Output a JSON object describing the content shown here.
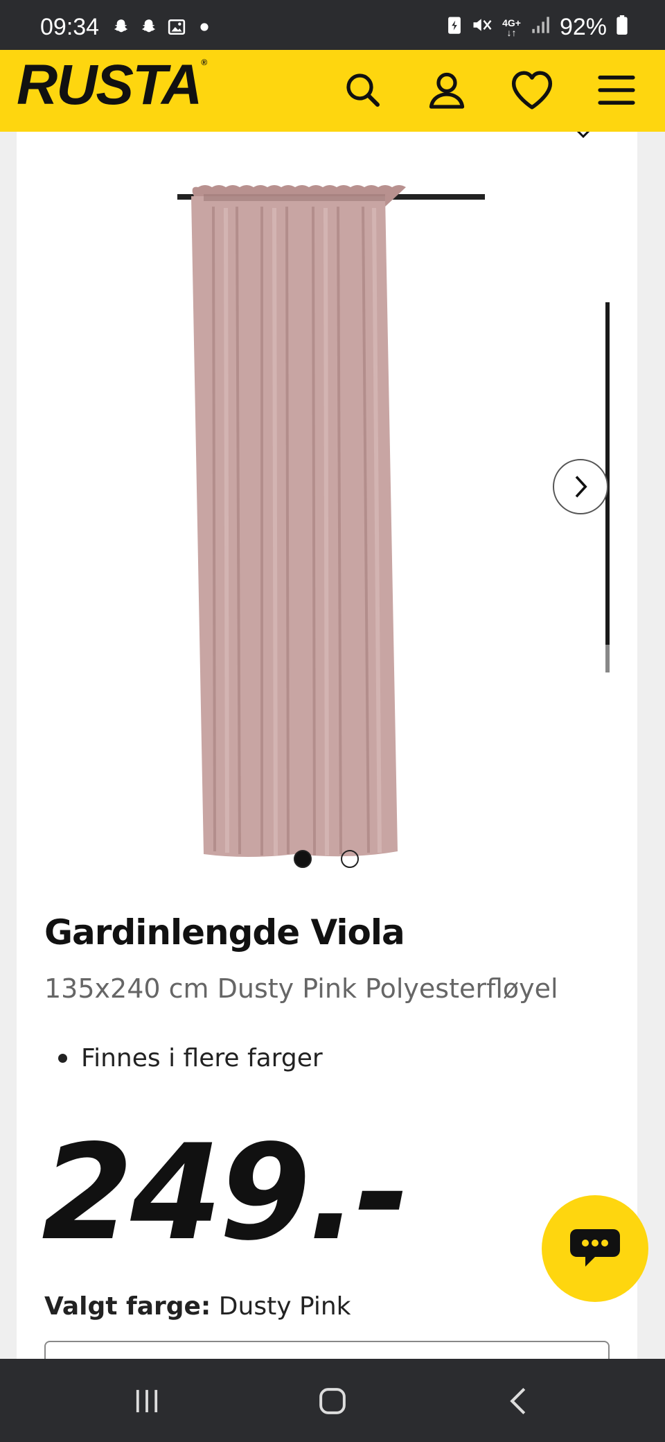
{
  "status_bar": {
    "time": "09:34",
    "battery": "92%",
    "network": "4G+",
    "left_icons": [
      "snapchat-icon",
      "snapchat-icon",
      "gallery-icon",
      "dot-icon"
    ],
    "right_icons": [
      "battery-saver-icon",
      "mute-icon",
      "network-icon",
      "signal-icon",
      "battery-icon"
    ]
  },
  "header": {
    "logo": "RUSTA",
    "logo_mark": "®",
    "icons": [
      "search-icon",
      "account-icon",
      "heart-icon",
      "menu-icon"
    ],
    "accent_color": "#fed60f"
  },
  "gallery": {
    "image": "curtain-product-image",
    "product_color": "#c8a5a3",
    "current_slide": 1,
    "total_slides": 2
  },
  "product": {
    "title": "Gardinlengde Viola",
    "subtitle": "135x240 cm Dusty Pink Polyesterfløyel",
    "bullets": [
      "Finnes i flere farger"
    ],
    "price": "249.-",
    "color_label": "Valgt farge:",
    "color_value": "Dusty Pink"
  },
  "chat": {
    "icon": "chat-icon"
  },
  "nav_bar": {
    "icons": [
      "recent-apps-icon",
      "home-icon",
      "back-icon"
    ]
  }
}
